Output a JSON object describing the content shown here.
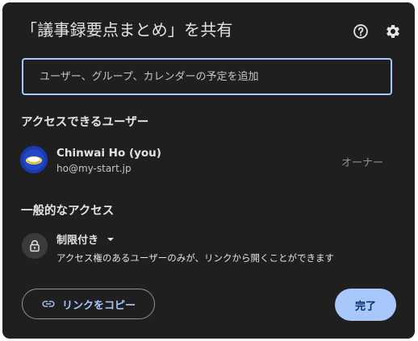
{
  "dialog": {
    "title": "「議事録要点まとめ」を共有",
    "help_icon": "help-circle-icon",
    "settings_icon": "gear-icon"
  },
  "share_input": {
    "placeholder": "ユーザー、グループ、カレンダーの予定を追加",
    "value": ""
  },
  "people_section": {
    "heading": "アクセスできるユーザー",
    "users": [
      {
        "name": "Chinwai Ho (you)",
        "email": "ho@my-start.jp",
        "role": "オーナー",
        "avatar_icon": "user-avatar"
      }
    ]
  },
  "general_access": {
    "heading": "一般的なアクセス",
    "level": "制限付き",
    "description": "アクセス権のあるユーザーのみが、リンクから開くことができます",
    "icon": "lock-icon",
    "dropdown_icon": "caret-down-icon"
  },
  "footer": {
    "copy_link_label": "リンクをコピー",
    "copy_link_icon": "link-icon",
    "done_label": "完了"
  },
  "colors": {
    "background": "#1f1f1f",
    "accent": "#a8c7fa",
    "text": "#e3e3e3",
    "muted": "#8e918f"
  }
}
